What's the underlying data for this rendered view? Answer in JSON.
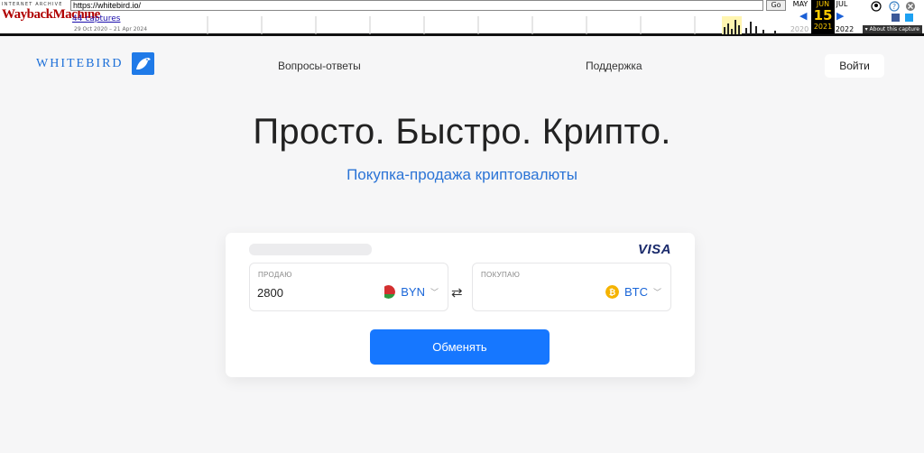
{
  "wayback": {
    "logo_top": "INTERNET ARCHIVE",
    "logo_main": "WaybackMachine",
    "url": "https://whitebird.io/",
    "go_label": "Go",
    "captures": "44 captures",
    "date_range": "29 Oct 2020 – 21 Apr 2024",
    "months": {
      "prev": "MAY",
      "current": "JUN",
      "next": "JUL"
    },
    "day": "15",
    "years": {
      "prev": "2020",
      "current": "2021",
      "next": "2022"
    },
    "about": "▾ About this capture"
  },
  "header": {
    "logo_text": "WHITEBIRD",
    "nav": [
      "Вопросы-ответы",
      "Поддержка"
    ],
    "login": "Войти"
  },
  "hero": {
    "title": "Просто. Быстро. Крипто.",
    "subtitle": "Покупка-продажа криптовалюты"
  },
  "exchange": {
    "card_brand": "VISA",
    "sell": {
      "label": "ПРОДАЮ",
      "value": "2800",
      "currency": "BYN"
    },
    "buy": {
      "label": "ПОКУПАЮ",
      "value": "",
      "currency": "BTC"
    },
    "submit": "Обменять"
  },
  "colors": {
    "accent": "#1677ff",
    "link": "#2b74d6",
    "btc": "#f5b300",
    "byn_red": "#d32f2f",
    "byn_green": "#2e9a3e"
  }
}
